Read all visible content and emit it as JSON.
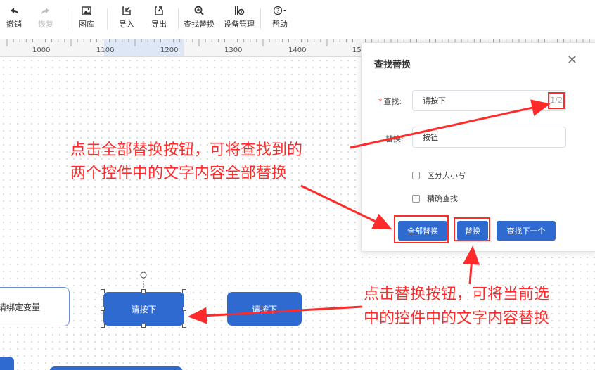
{
  "toolbar": {
    "items": [
      {
        "label": "撤销",
        "icon": "undo-icon",
        "disabled": false
      },
      {
        "label": "恢复",
        "icon": "redo-icon",
        "disabled": true
      },
      {
        "label": "图库",
        "icon": "image-library-icon",
        "disabled": false
      },
      {
        "label": "导入",
        "icon": "import-icon",
        "disabled": false
      },
      {
        "label": "导出",
        "icon": "export-icon",
        "disabled": false
      },
      {
        "label": "查找替换",
        "icon": "find-replace-icon",
        "disabled": false
      },
      {
        "label": "设备管理",
        "icon": "device-management-icon",
        "disabled": false
      },
      {
        "label": "帮助",
        "icon": "help-icon",
        "disabled": false
      }
    ]
  },
  "ruler": {
    "labels": [
      "1000",
      "1100",
      "1200",
      "1300",
      "1400",
      "15"
    ]
  },
  "canvas": {
    "node_left_label": "请绑定变量",
    "node_selected_label": "请按下",
    "node_right_label": "请按下"
  },
  "dialog": {
    "title": "查找替换",
    "find_label": "查找:",
    "find_value": "请按下",
    "match_count": "1/2",
    "replace_label": "替换:",
    "replace_value": "按钮",
    "case_sensitive_label": "区分大小写",
    "exact_match_label": "精确查找",
    "replace_all_button": "全部替换",
    "replace_button": "替换",
    "find_next_button": "查找下一个"
  },
  "annotations": {
    "top_line1": "点击全部替换按钮，可将查找到的",
    "top_line2": "两个控件中的文字内容全部替换",
    "bottom_line1": "点击替换按钮，可将当前选",
    "bottom_line2": "中的控件中的文字内容替换",
    "color": "#ff2b2b"
  },
  "colors": {
    "accent": "#2f6ad0",
    "annotation": "#ff2b2b"
  }
}
